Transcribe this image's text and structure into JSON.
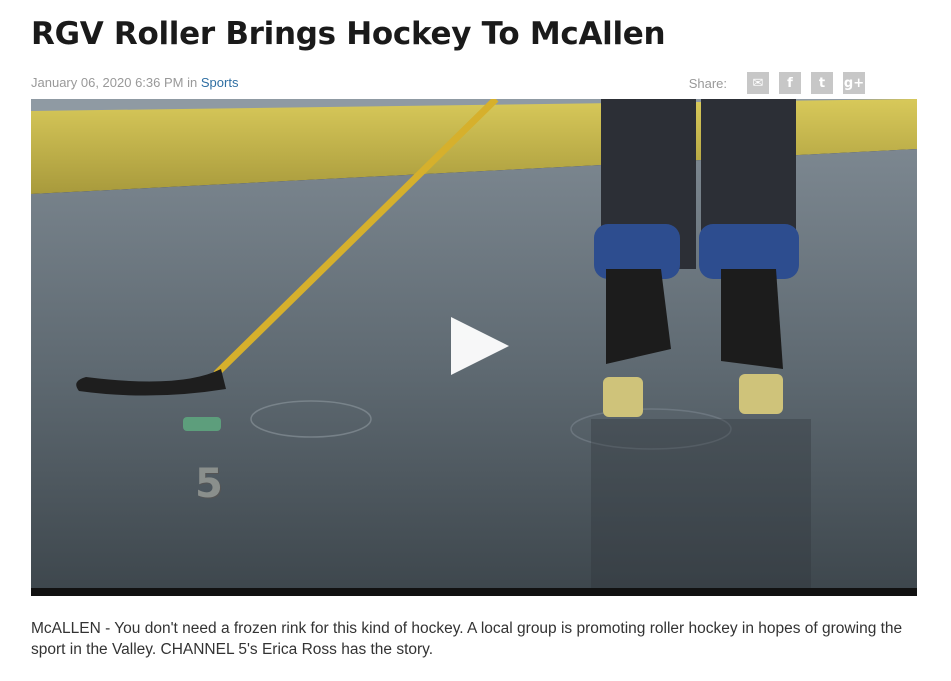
{
  "article": {
    "title": "RGV Roller Brings Hockey To McAllen",
    "date": "January 06, 2020 6:36 PM",
    "in_word": "in",
    "category": "Sports",
    "body": "McALLEN - You don't need a frozen rink for this kind of hockey. A local group is promoting roller hockey in hopes of growing the sport in the Valley. CHANNEL 5's Erica Ross has the story."
  },
  "share": {
    "label": "Share:",
    "buttons": [
      {
        "name": "email-icon",
        "glyph": "✉"
      },
      {
        "name": "facebook-icon",
        "glyph": "f"
      },
      {
        "name": "twitter-icon",
        "glyph": "t"
      },
      {
        "name": "google-plus-icon",
        "glyph": "g+"
      }
    ]
  },
  "video": {
    "channel_logo": "5",
    "play_icon": "play-icon"
  },
  "colors": {
    "link": "#2f6fa3",
    "share_button": "#c7c7c7",
    "rink_floor": "#5d6870",
    "boards": "#c9b74a"
  }
}
